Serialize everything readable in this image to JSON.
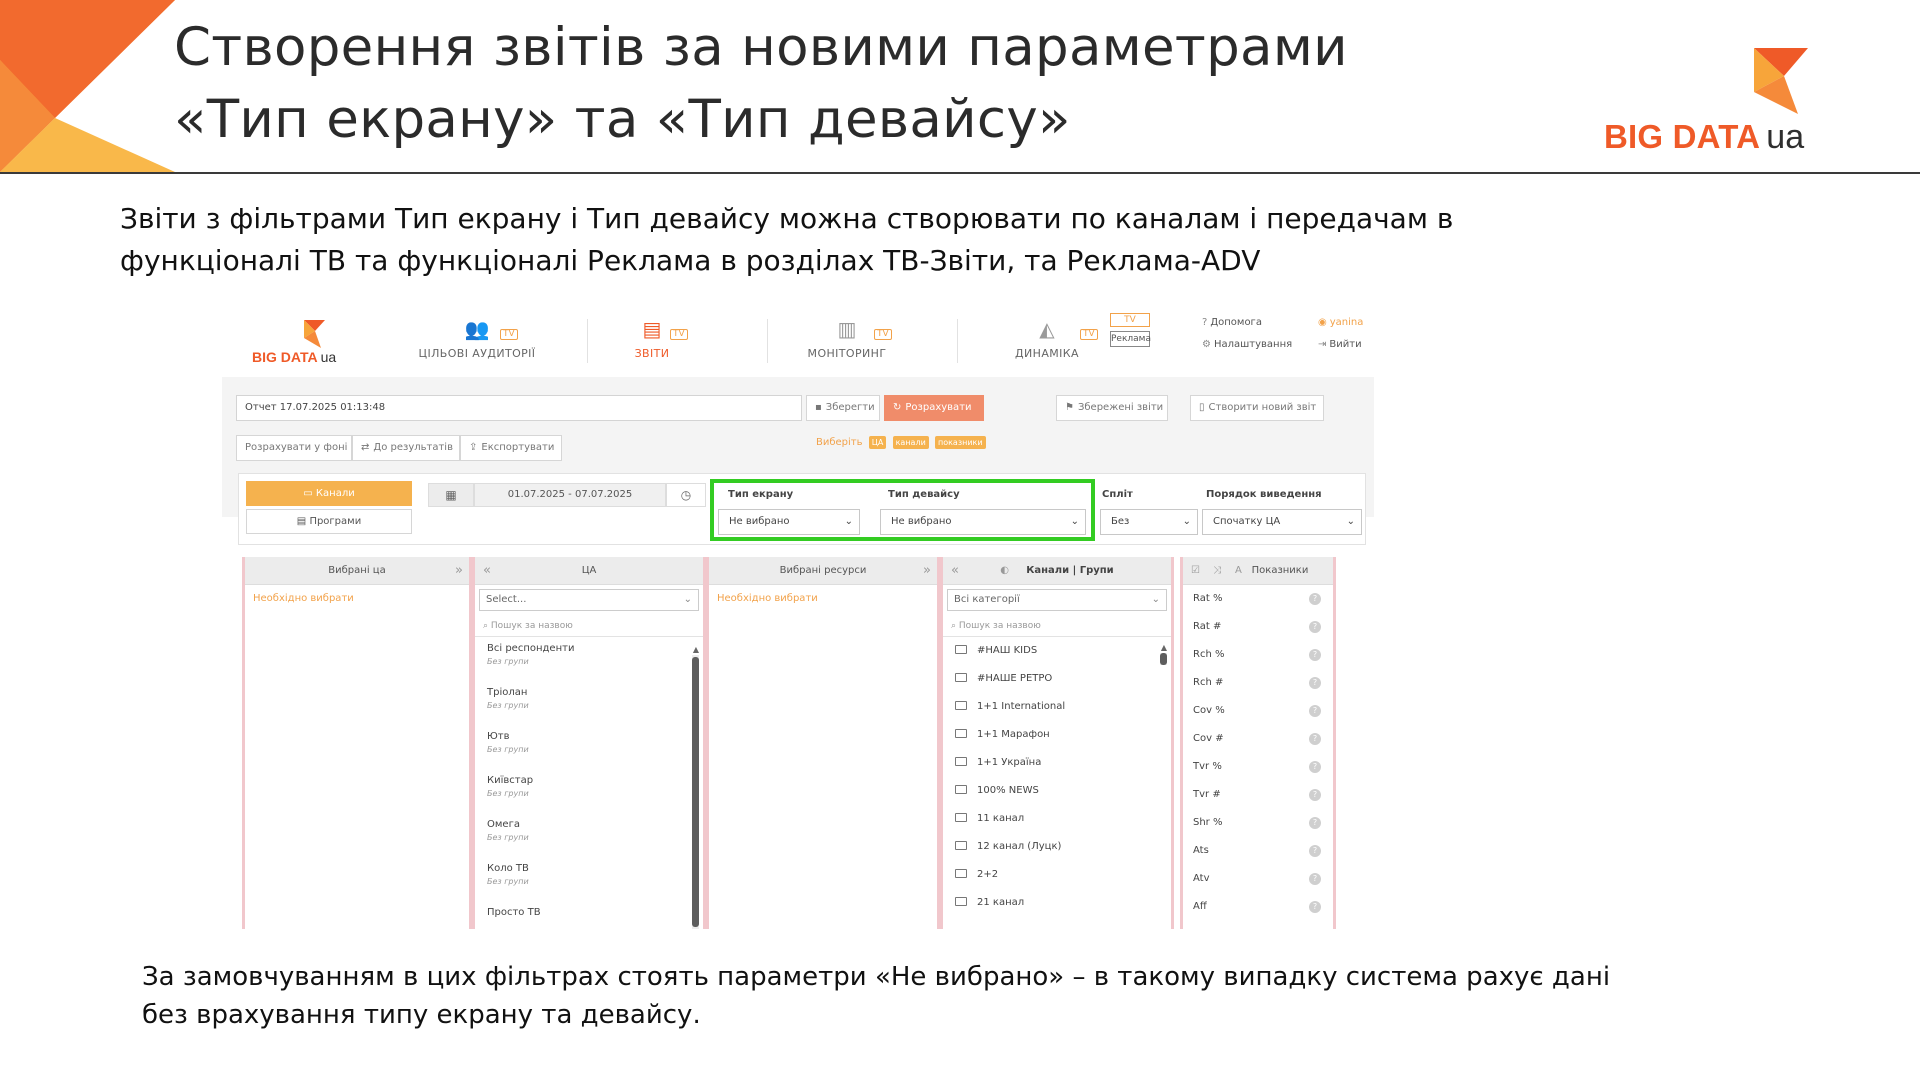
{
  "slide": {
    "title_line1": "Створення звітів за новими параметрами",
    "title_line2": "«Тип екрану» та «Тип девайсу»",
    "intro_line1": "Звіти з фільтрами Тип екрану і Тип девайсу можна створювати по каналам і передачам в",
    "intro_line2": "функціоналі ТВ та функціоналі Реклама в розділах  ТВ-Звіти, та Реклама-ADV",
    "outro_line1": "За замовчуванням в цих фільтрах стоять параметри «Не вибрано» – в такому випадку система рахує дані",
    "outro_line2": "без врахування типу екрану та девайсу.",
    "logo_word": "BIG DATA",
    "logo_ua": "ua"
  },
  "colors": {
    "brand_orange": "#ef5a28",
    "accent_orange": "#f5b24e",
    "highlight_green": "#33cc22"
  },
  "app": {
    "logo_word": "BIG DATA",
    "logo_ua": "ua",
    "nav": {
      "audiences": "ЦІЛЬОВІ АУДИТОРІЇ",
      "reports": "ЗВІТИ",
      "monitoring": "МОНІТОРИНГ",
      "dynamics": "ДИНАМІКА",
      "reklama": "Реклама"
    },
    "util": {
      "help": "Допомога",
      "settings": "Налаштування",
      "user": "yanina",
      "logout": "Вийти"
    },
    "report_name": "Отчет 17.07.2025 01:13:48",
    "buttons": {
      "save": "Зберегти",
      "calculate": "Розрахувати",
      "saved_reports": "Збережені звіти",
      "new_report": "Створити новий звіт",
      "bg_calc": "Розрахувати у фоні",
      "to_results": "До результатів",
      "export": "Експортувати"
    },
    "hint": {
      "text": "Виберіть",
      "tags": [
        "ЦА",
        "канали",
        "показники"
      ]
    },
    "filters": {
      "channels": "Канали",
      "programs": "Програми",
      "date_range": "01.07.2025 - 07.07.2025",
      "screen_type_label": "Тип екрану",
      "screen_type_value": "Не вибрано",
      "device_type_label": "Тип девайсу",
      "device_type_value": "Не вибрано",
      "split_label": "Спліт",
      "split_value": "Без",
      "order_label": "Порядок виведення",
      "order_value": "Спочатку ЦА"
    },
    "panels": {
      "selected_ta": "Вибрані ца",
      "need_select": "Необхідно вибрати",
      "ta": "ЦА",
      "ta_select": "Select...",
      "search": "Пошук за назвою",
      "selected_resources": "Вибрані ресурси",
      "channels_groups": "Канали | Групи",
      "all_categories": "Всі категорії",
      "indicators": "Показники"
    },
    "ta_items": [
      {
        "name": "Всі респонденти",
        "sub": "Без групи"
      },
      {
        "name": "Тріолан",
        "sub": "Без групи"
      },
      {
        "name": "Ютв",
        "sub": "Без групи"
      },
      {
        "name": "Київстар",
        "sub": "Без групи"
      },
      {
        "name": "Омега",
        "sub": "Без групи"
      },
      {
        "name": "Коло ТВ",
        "sub": "Без групи"
      },
      {
        "name": "Просто ТВ",
        "sub": ""
      }
    ],
    "channels": [
      "#НАШ KIDS",
      "#НАШЕ РЕТРО",
      "1+1 International",
      "1+1 Марафон",
      "1+1 Україна",
      "100% NEWS",
      "11 канал",
      "12 канал (Луцк)",
      "2+2",
      "21 канал"
    ],
    "indicators": [
      "Rat %",
      "Rat #",
      "Rch %",
      "Rch #",
      "Cov %",
      "Cov #",
      "Tvr %",
      "Tvr #",
      "Shr %",
      "Ats",
      "Atv",
      "Aff"
    ]
  }
}
